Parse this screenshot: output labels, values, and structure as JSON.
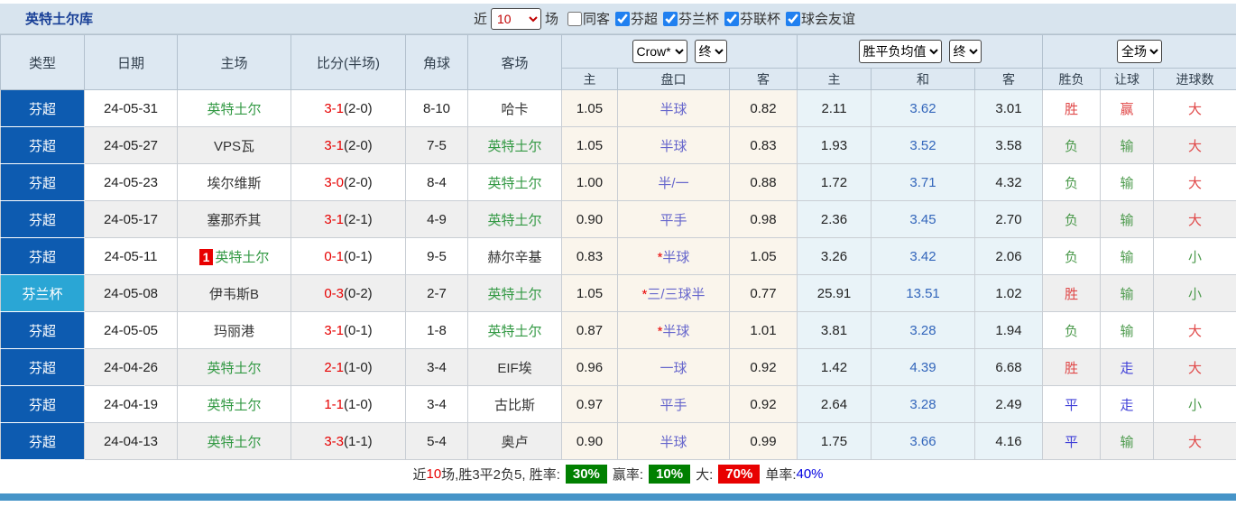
{
  "title": "英特土尔库",
  "filter": {
    "near_label": "近",
    "matches_value": "10",
    "matches_label": "场",
    "options": [
      {
        "label": "同客",
        "checked": false
      },
      {
        "label": "芬超",
        "checked": true
      },
      {
        "label": "芬兰杯",
        "checked": true
      },
      {
        "label": "芬联杯",
        "checked": true
      },
      {
        "label": "球会友谊",
        "checked": true
      }
    ]
  },
  "table": {
    "col_headers": {
      "type": "类型",
      "date": "日期",
      "home": "主场",
      "score": "比分(半场)",
      "corner": "角球",
      "away": "客场",
      "asia_home": "主",
      "asia_line": "盘口",
      "asia_away": "客",
      "odds_home": "主",
      "odds_draw": "和",
      "odds_away": "客",
      "result_wl": "胜负",
      "result_handicap": "让球",
      "result_goals": "进球数"
    },
    "selects": {
      "bookmaker": "Crow*",
      "asia_time": "终",
      "odds_type": "胜平负均值",
      "odds_time": "终",
      "result_scope": "全场"
    },
    "rows": [
      {
        "type": "芬超",
        "type_style": "league",
        "date": "24-05-31",
        "badge": "",
        "home": "英特土尔",
        "home_self": true,
        "score_ft": "3-1",
        "score_ht": "(2-0)",
        "corner": "8-10",
        "away": "哈卡",
        "away_self": false,
        "asia_home": "1.05",
        "asia_star": "",
        "asia_line": "半球",
        "asia_away": "0.82",
        "o_home": "2.11",
        "o_draw": "3.62",
        "o_away": "3.01",
        "r_wl": "胜",
        "r_wl_c": "red",
        "r_h": "赢",
        "r_h_c": "red",
        "r_g": "大",
        "r_g_c": "red"
      },
      {
        "type": "芬超",
        "type_style": "league",
        "date": "24-05-27",
        "badge": "",
        "home": "VPS瓦",
        "home_self": false,
        "score_ft": "3-1",
        "score_ht": "(2-0)",
        "corner": "7-5",
        "away": "英特土尔",
        "away_self": true,
        "asia_home": "1.05",
        "asia_star": "",
        "asia_line": "半球",
        "asia_away": "0.83",
        "o_home": "1.93",
        "o_draw": "3.52",
        "o_away": "3.58",
        "r_wl": "负",
        "r_wl_c": "green",
        "r_h": "输",
        "r_h_c": "green",
        "r_g": "大",
        "r_g_c": "red"
      },
      {
        "type": "芬超",
        "type_style": "league",
        "date": "24-05-23",
        "badge": "",
        "home": "埃尔维斯",
        "home_self": false,
        "score_ft": "3-0",
        "score_ht": "(2-0)",
        "corner": "8-4",
        "away": "英特土尔",
        "away_self": true,
        "asia_home": "1.00",
        "asia_star": "",
        "asia_line": "半/一",
        "asia_away": "0.88",
        "o_home": "1.72",
        "o_draw": "3.71",
        "o_away": "4.32",
        "r_wl": "负",
        "r_wl_c": "green",
        "r_h": "输",
        "r_h_c": "green",
        "r_g": "大",
        "r_g_c": "red"
      },
      {
        "type": "芬超",
        "type_style": "league",
        "date": "24-05-17",
        "badge": "",
        "home": "塞那乔其",
        "home_self": false,
        "score_ft": "3-1",
        "score_ht": "(2-1)",
        "corner": "4-9",
        "away": "英特土尔",
        "away_self": true,
        "asia_home": "0.90",
        "asia_star": "",
        "asia_line": "平手",
        "asia_away": "0.98",
        "o_home": "2.36",
        "o_draw": "3.45",
        "o_away": "2.70",
        "r_wl": "负",
        "r_wl_c": "green",
        "r_h": "输",
        "r_h_c": "green",
        "r_g": "大",
        "r_g_c": "red"
      },
      {
        "type": "芬超",
        "type_style": "league",
        "date": "24-05-11",
        "badge": "1",
        "home": "英特土尔",
        "home_self": true,
        "score_ft": "0-1",
        "score_ht": "(0-1)",
        "corner": "9-5",
        "away": "赫尔辛基",
        "away_self": false,
        "asia_home": "0.83",
        "asia_star": "*",
        "asia_line": "半球",
        "asia_away": "1.05",
        "o_home": "3.26",
        "o_draw": "3.42",
        "o_away": "2.06",
        "r_wl": "负",
        "r_wl_c": "green",
        "r_h": "输",
        "r_h_c": "green",
        "r_g": "小",
        "r_g_c": "green"
      },
      {
        "type": "芬兰杯",
        "type_style": "cup",
        "date": "24-05-08",
        "badge": "",
        "home": "伊韦斯B",
        "home_self": false,
        "score_ft": "0-3",
        "score_ht": "(0-2)",
        "corner": "2-7",
        "away": "英特土尔",
        "away_self": true,
        "asia_home": "1.05",
        "asia_star": "*",
        "asia_line": "三/三球半",
        "asia_away": "0.77",
        "o_home": "25.91",
        "o_draw": "13.51",
        "o_away": "1.02",
        "r_wl": "胜",
        "r_wl_c": "red",
        "r_h": "输",
        "r_h_c": "green",
        "r_g": "小",
        "r_g_c": "green"
      },
      {
        "type": "芬超",
        "type_style": "league",
        "date": "24-05-05",
        "badge": "",
        "home": "玛丽港",
        "home_self": false,
        "score_ft": "3-1",
        "score_ht": "(0-1)",
        "corner": "1-8",
        "away": "英特土尔",
        "away_self": true,
        "asia_home": "0.87",
        "asia_star": "*",
        "asia_line": "半球",
        "asia_away": "1.01",
        "o_home": "3.81",
        "o_draw": "3.28",
        "o_away": "1.94",
        "r_wl": "负",
        "r_wl_c": "green",
        "r_h": "输",
        "r_h_c": "green",
        "r_g": "大",
        "r_g_c": "red"
      },
      {
        "type": "芬超",
        "type_style": "league",
        "date": "24-04-26",
        "badge": "",
        "home": "英特土尔",
        "home_self": true,
        "score_ft": "2-1",
        "score_ht": "(1-0)",
        "corner": "3-4",
        "away": "EIF埃",
        "away_self": false,
        "asia_home": "0.96",
        "asia_star": "",
        "asia_line": "一球",
        "asia_away": "0.92",
        "o_home": "1.42",
        "o_draw": "4.39",
        "o_away": "6.68",
        "r_wl": "胜",
        "r_wl_c": "red",
        "r_h": "走",
        "r_h_c": "blue",
        "r_g": "大",
        "r_g_c": "red"
      },
      {
        "type": "芬超",
        "type_style": "league",
        "date": "24-04-19",
        "badge": "",
        "home": "英特土尔",
        "home_self": true,
        "score_ft": "1-1",
        "score_ht": "(1-0)",
        "corner": "3-4",
        "away": "古比斯",
        "away_self": false,
        "asia_home": "0.97",
        "asia_star": "",
        "asia_line": "平手",
        "asia_away": "0.92",
        "o_home": "2.64",
        "o_draw": "3.28",
        "o_away": "2.49",
        "r_wl": "平",
        "r_wl_c": "blue",
        "r_h": "走",
        "r_h_c": "blue",
        "r_g": "小",
        "r_g_c": "green"
      },
      {
        "type": "芬超",
        "type_style": "league",
        "date": "24-04-13",
        "badge": "",
        "home": "英特土尔",
        "home_self": true,
        "score_ft": "3-3",
        "score_ht": "(1-1)",
        "corner": "5-4",
        "away": "奥卢",
        "away_self": false,
        "asia_home": "0.90",
        "asia_star": "",
        "asia_line": "半球",
        "asia_away": "0.99",
        "o_home": "1.75",
        "o_draw": "3.66",
        "o_away": "4.16",
        "r_wl": "平",
        "r_wl_c": "blue",
        "r_h": "输",
        "r_h_c": "green",
        "r_g": "大",
        "r_g_c": "red"
      }
    ]
  },
  "footer": {
    "near": "近",
    "count": "10",
    "summary": "场,胜3平2负5, 胜率:",
    "win_rate": "30%",
    "handicap_label": "赢率:",
    "handicap_rate": "10%",
    "big_label": "大:",
    "big_rate": "70%",
    "single_label": "单率:",
    "single_rate": "40%"
  },
  "colors": {
    "league_blue": "#0d5bb0",
    "cup_cyan": "#2aa6d5",
    "self_green": "#339944",
    "score_red": "#e60000",
    "line_purple": "#6666cc",
    "draw_blue": "#3366bb",
    "res_red": "#e04848",
    "res_green": "#4c9a4c",
    "res_blue": "#4040d8",
    "badge_green": "#008000",
    "badge_red": "#e80000",
    "rate_blue": "#0000e0",
    "bottom_bar": "#4694c8"
  }
}
